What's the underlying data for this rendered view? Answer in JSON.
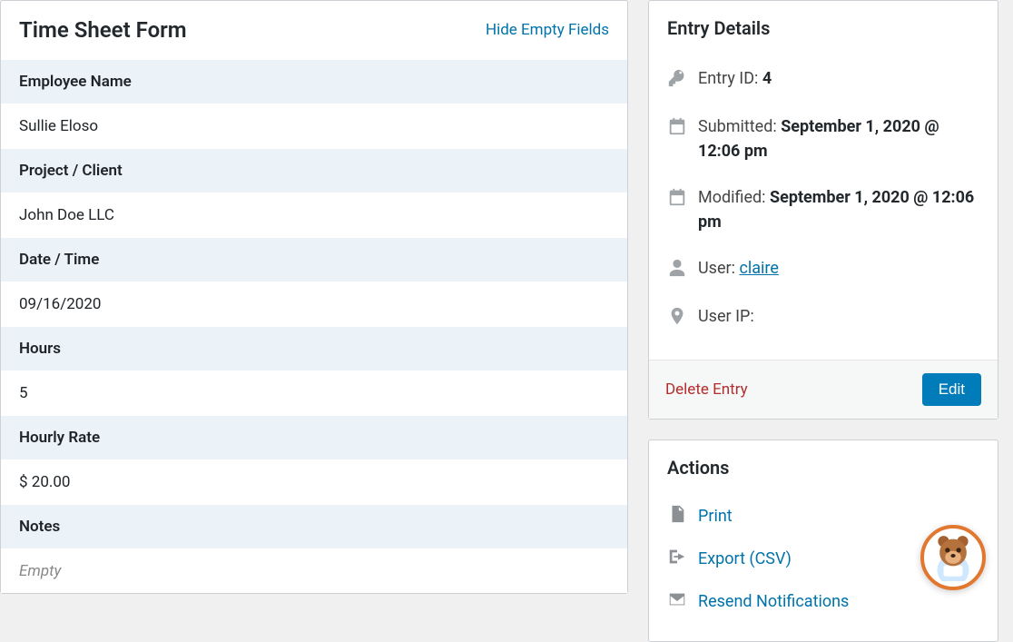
{
  "main": {
    "title": "Time Sheet Form",
    "hide_link": "Hide Empty Fields",
    "fields": {
      "employee_label": "Employee Name",
      "employee_value": "Sullie Eloso",
      "project_label": "Project / Client",
      "project_value": "John Doe LLC",
      "date_label": "Date / Time",
      "date_value": "09/16/2020",
      "hours_label": "Hours",
      "hours_value": "5",
      "rate_label": "Hourly Rate",
      "rate_value": "$ 20.00",
      "notes_label": "Notes",
      "notes_value": "Empty"
    }
  },
  "details": {
    "title": "Entry Details",
    "entry_id_label": "Entry ID: ",
    "entry_id_value": "4",
    "submitted_label": "Submitted: ",
    "submitted_value": "September 1, 2020 @ 12:06 pm",
    "modified_label": "Modified: ",
    "modified_value": "September 1, 2020 @ 12:06 pm",
    "user_label": "User: ",
    "user_value": "claire",
    "user_ip_label": "User IP: ",
    "user_ip_value": "",
    "delete": "Delete Entry",
    "edit": "Edit"
  },
  "actions": {
    "title": "Actions",
    "print": "Print",
    "export": "Export (CSV)",
    "resend": "Resend Notifications"
  }
}
